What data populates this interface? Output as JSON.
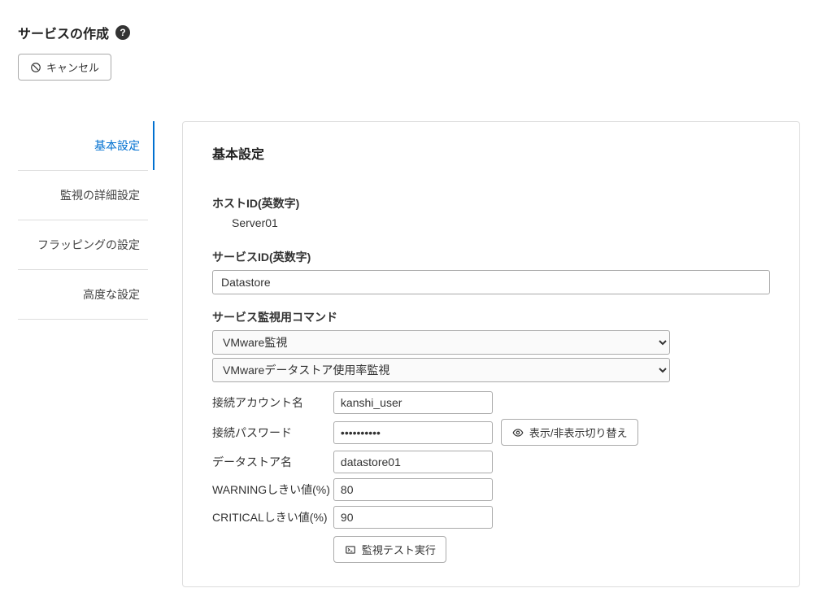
{
  "header": {
    "title": "サービスの作成",
    "help_symbol": "?",
    "cancel_label": "キャンセル"
  },
  "sidebar": {
    "items": [
      {
        "label": "基本設定",
        "active": true
      },
      {
        "label": "監視の詳細設定",
        "active": false
      },
      {
        "label": "フラッピングの設定",
        "active": false
      },
      {
        "label": "高度な設定",
        "active": false
      }
    ]
  },
  "panel": {
    "title": "基本設定",
    "host_id_label": "ホストID(英数字)",
    "host_id_value": "Server01",
    "service_id_label": "サービスID(英数字)",
    "service_id_value": "Datastore",
    "command_label": "サービス監視用コマンド",
    "command_select1": "VMware監視",
    "command_select2": "VMwareデータストア使用率監視",
    "params": {
      "account_label": "接続アカウント名",
      "account_value": "kanshi_user",
      "password_label": "接続パスワード",
      "password_value": "••••••••••",
      "toggle_button": "表示/非表示切り替え",
      "datastore_label": "データストア名",
      "datastore_value": "datastore01",
      "warning_label": "WARNINGしきい値(%)",
      "warning_value": "80",
      "critical_label": "CRITICALしきい値(%)",
      "critical_value": "90",
      "test_button": "監視テスト実行"
    }
  }
}
